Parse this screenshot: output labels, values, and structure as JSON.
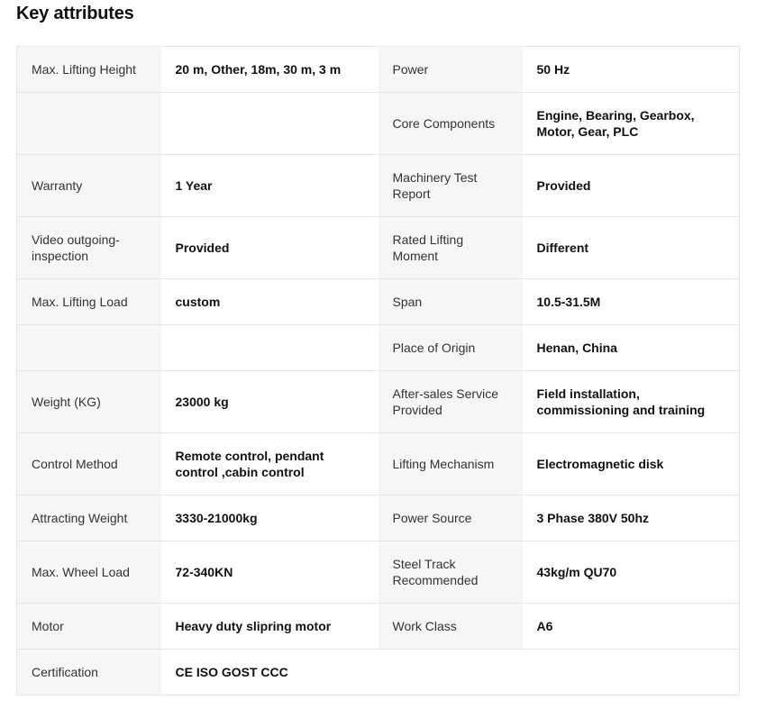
{
  "title": "Key attributes",
  "rows": [
    {
      "k1": "Max. Lifting Height",
      "v1": "20 m, Other, 18m, 30 m, 3 m",
      "k2": "Power",
      "v2": "50 Hz"
    },
    {
      "k1": "",
      "v1": "",
      "k2": "Core Components",
      "v2": "Engine, Bearing, Gearbox, Motor, Gear, PLC"
    },
    {
      "k1": "Warranty",
      "v1": "1 Year",
      "k2": "Machinery Test Report",
      "v2": "Provided"
    },
    {
      "k1": "Video outgoing-inspection",
      "v1": "Provided",
      "k2": "Rated Lifting Moment",
      "v2": "Different"
    },
    {
      "k1": "Max. Lifting Load",
      "v1": "custom",
      "k2": "Span",
      "v2": "10.5-31.5M"
    },
    {
      "k1": "",
      "v1": "",
      "k2": "Place of Origin",
      "v2": "Henan, China"
    },
    {
      "k1": "Weight (KG)",
      "v1": "23000 kg",
      "k2": "After-sales Service Provided",
      "v2": "Field installation, commissioning and training"
    },
    {
      "k1": "Control Method",
      "v1": "Remote control, pendant control ,cabin control",
      "k2": "Lifting Mechanism",
      "v2": "Electromagnetic disk"
    },
    {
      "k1": "Attracting Weight",
      "v1": "3330-21000kg",
      "k2": "Power Source",
      "v2": "3 Phase 380V 50hz"
    },
    {
      "k1": "Max. Wheel Load",
      "v1": "72-340KN",
      "k2": "Steel Track Recommended",
      "v2": "43kg/m QU70"
    },
    {
      "k1": "Motor",
      "v1": "Heavy duty slipring motor",
      "k2": "Work Class",
      "v2": "A6"
    },
    {
      "k1": "Certification",
      "v1": "CE ISO GOST CCC",
      "k2": "",
      "v2": ""
    }
  ]
}
